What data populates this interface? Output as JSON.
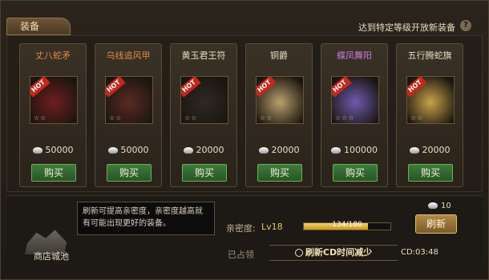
{
  "header": {
    "tab_label": "装备",
    "hint": "达到特定等级开放新装备",
    "help": "?"
  },
  "items": [
    {
      "name": "丈八蛇矛",
      "name_color": "#e08a4a",
      "hot": "HOT",
      "stars": "☆☆",
      "price": "50000",
      "buy": "购买",
      "art": "#6e1e1e"
    },
    {
      "name": "乌线追风甲",
      "name_color": "#e08a4a",
      "hot": "HOT",
      "stars": "☆☆",
      "price": "50000",
      "buy": "购买",
      "art": "#5a2a22"
    },
    {
      "name": "黄玉君王符",
      "name_color": "#e8dcc0",
      "hot": "HOT",
      "stars": "☆☆",
      "price": "20000",
      "buy": "购买",
      "art": "#2e2a22"
    },
    {
      "name": "铜爵",
      "name_color": "#e8dcc0",
      "hot": "HOT",
      "stars": "☆☆",
      "price": "20000",
      "buy": "购买",
      "art": "#b9a06a"
    },
    {
      "name": "蝶凤舞阳",
      "name_color": "#c47be0",
      "hot": "HOT",
      "stars": "☆☆☆",
      "price": "100000",
      "buy": "购买",
      "art": "#6e5ab0"
    },
    {
      "name": "五行腾蛇旗",
      "name_color": "#e8dcc0",
      "hot": "HOT",
      "stars": "☆☆",
      "price": "20000",
      "buy": "购买",
      "art": "#c9a24a"
    }
  ],
  "bottom": {
    "tip": "刷新可提高亲密度，亲密度越高就有可能出现更好的装备。",
    "city_label": "商店城池",
    "intimacy_label": "亲密度:",
    "intimacy_level": "Lv18",
    "progress_text": "134/180",
    "progress_fraction": 0.744,
    "refresh_cost": "10",
    "refresh_button": "刷新",
    "claimed": "已占领",
    "cd_banner": "刷新CD时间减少",
    "cd_timer": "CD:03:48"
  }
}
